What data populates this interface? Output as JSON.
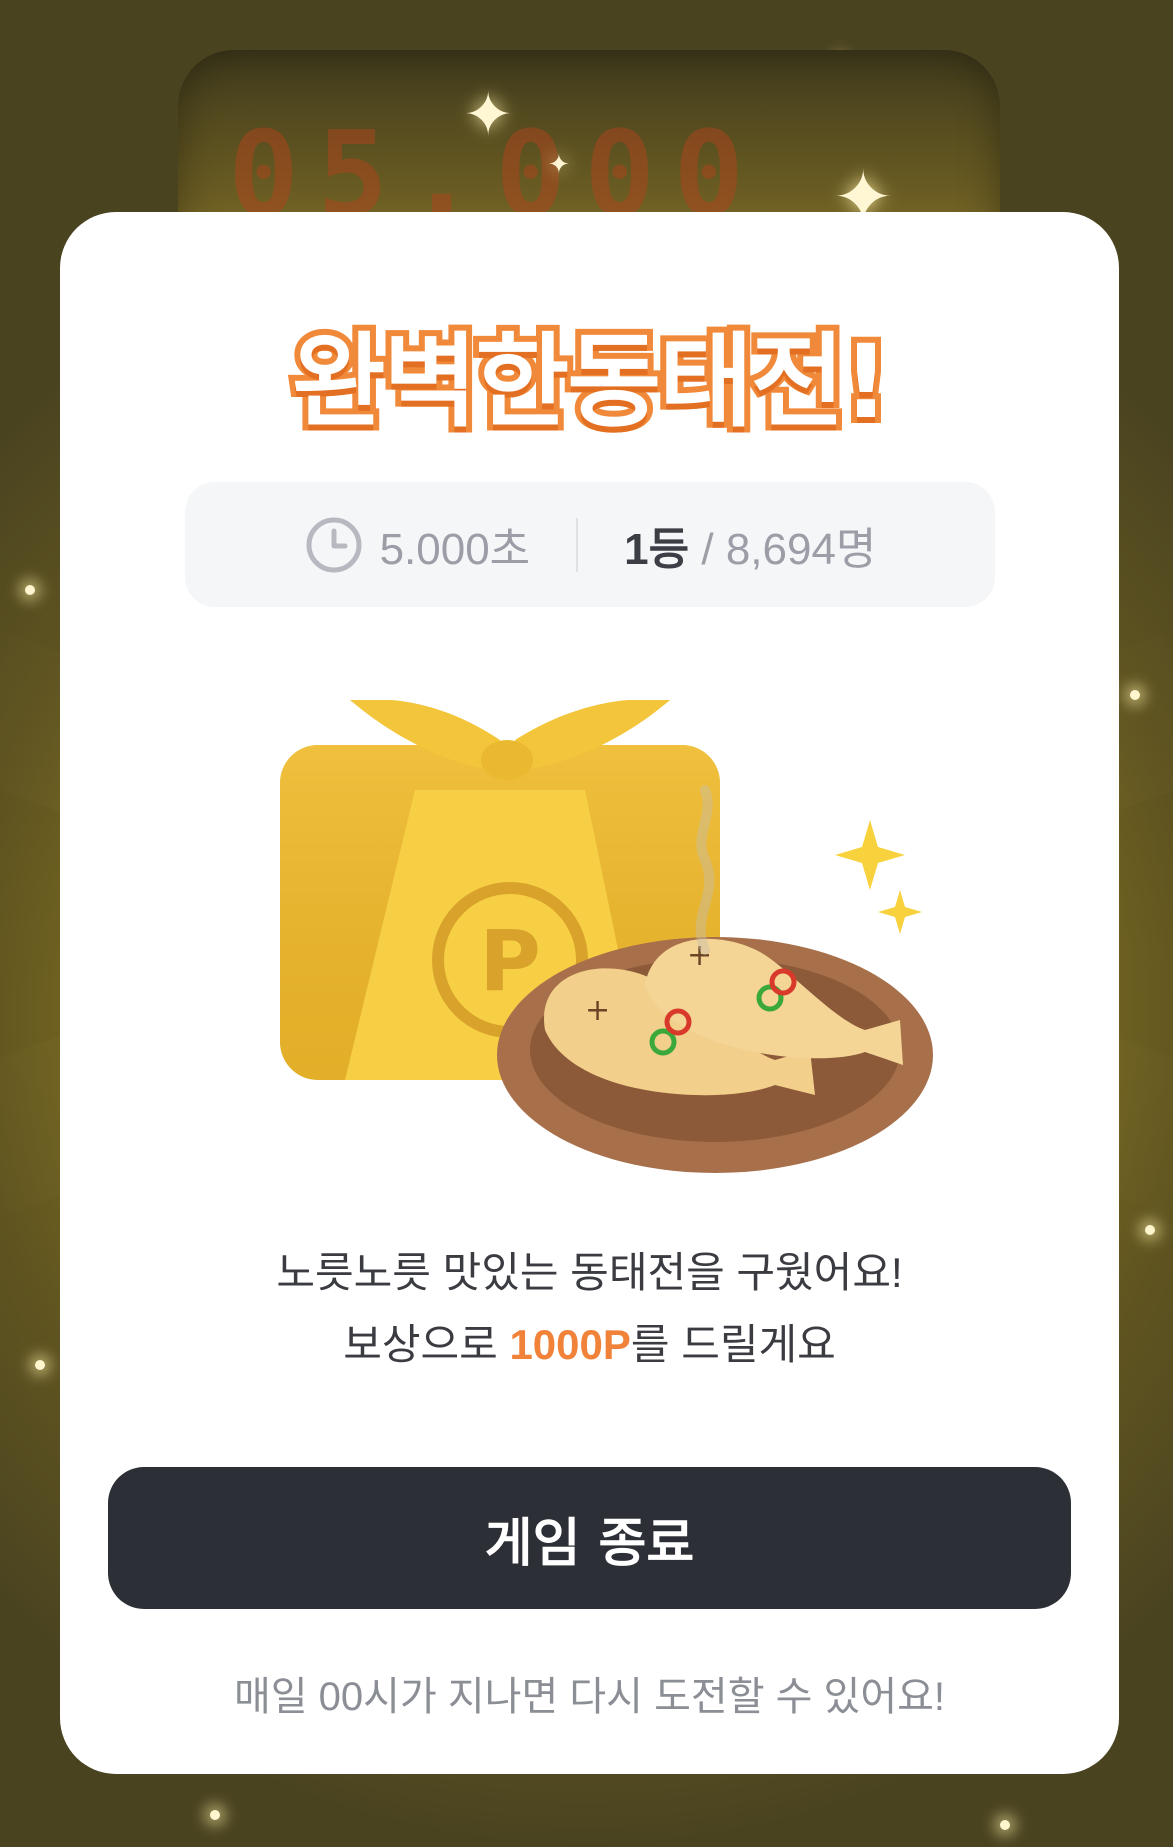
{
  "background": {
    "scoreboard_digits": "05.000"
  },
  "result": {
    "title": "완벽한동태전!",
    "time": "5.000초",
    "rank": "1등",
    "rank_separator": "/",
    "participants": "8,694명"
  },
  "reward": {
    "line1": "노릇노릇 맛있는 동태전을 구웠어요!",
    "line2_prefix": "보상으로 ",
    "points": "1000P",
    "line2_suffix": "를 드릴게요",
    "gift_mark": "P"
  },
  "actions": {
    "end_game_label": "게임 종료"
  },
  "footnote": "매일 00시가 지나면 다시 도전할 수 있어요!",
  "colors": {
    "accent_orange": "#f0823a",
    "button_dark": "#2c2f36",
    "gift_gold": "#f2c53a"
  },
  "icons": [
    "clock-icon",
    "sparkle-icon",
    "gift-box-icon",
    "fried-fish-icon"
  ]
}
